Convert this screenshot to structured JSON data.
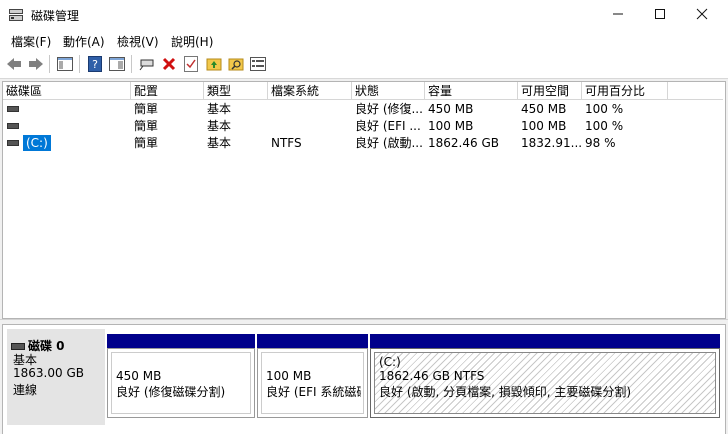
{
  "window": {
    "title": "磁碟管理"
  },
  "menu": [
    "檔案(F)",
    "動作(A)",
    "檢視(V)",
    "說明(H)"
  ],
  "columns": [
    "磁碟區",
    "配置",
    "類型",
    "檔案系統",
    "狀態",
    "容量",
    "可用空間",
    "可用百分比"
  ],
  "volumes": [
    {
      "name": "",
      "layout": "簡單",
      "type": "基本",
      "fs": "",
      "status": "良好 (修復...",
      "capacity": "450 MB",
      "free": "450 MB",
      "pct": "100 %"
    },
    {
      "name": "",
      "layout": "簡單",
      "type": "基本",
      "fs": "",
      "status": "良好 (EFI ...",
      "capacity": "100 MB",
      "free": "100 MB",
      "pct": "100 %"
    },
    {
      "name": "(C:)",
      "layout": "簡單",
      "type": "基本",
      "fs": "NTFS",
      "status": "良好 (啟動...",
      "capacity": "1862.46 GB",
      "free": "1832.91...",
      "pct": "98 %"
    }
  ],
  "disk": {
    "name": "磁碟 0",
    "type": "基本",
    "size": "1863.00 GB",
    "state": "連線",
    "partitions": [
      {
        "title": "",
        "line1": "450 MB",
        "line2": "良好 (修復磁碟分割)"
      },
      {
        "title": "",
        "line1": "100 MB",
        "line2": "良好 (EFI 系統磁碟:"
      },
      {
        "title": "(C:)",
        "line1": "1862.46 GB NTFS",
        "line2": "良好 (啟動, 分頁檔案, 損毀傾印, 主要磁碟分割)"
      }
    ]
  },
  "colors": {
    "partition_bar": "#00008b",
    "selection": "#0078d7"
  }
}
